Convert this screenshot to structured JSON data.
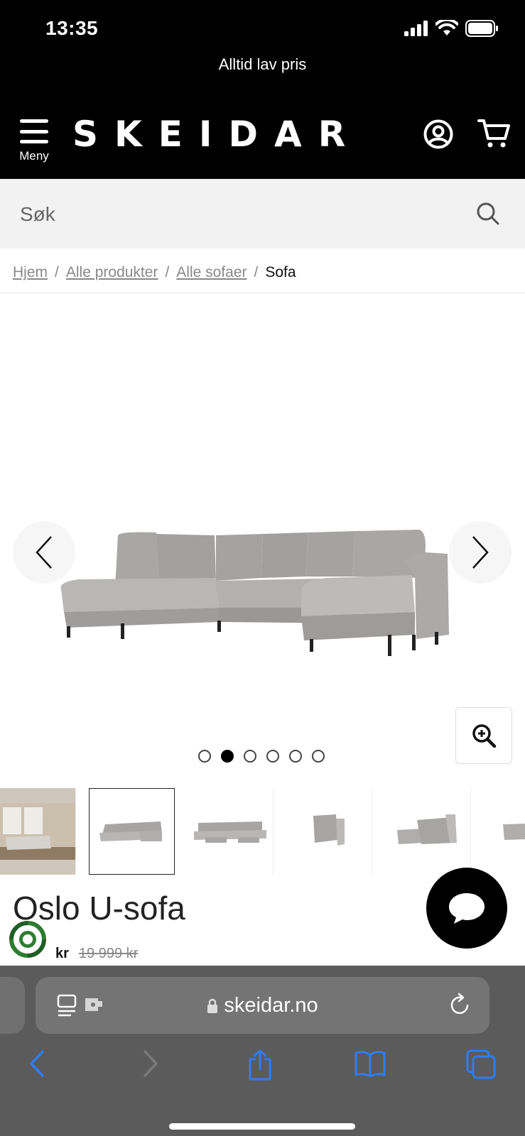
{
  "status_bar": {
    "time": "13:35"
  },
  "header": {
    "promo": "Alltid lav pris",
    "menu_label": "Meny",
    "logo": "SKEIDAR"
  },
  "search": {
    "placeholder": "Søk"
  },
  "breadcrumb": {
    "items": [
      "Hjem",
      "Alle produkter",
      "Alle sofaer"
    ],
    "current": "Sofa",
    "separator": "/"
  },
  "gallery": {
    "dots_count": 6,
    "active_dot_index": 1,
    "thumbnail_count": 6,
    "selected_thumbnail_index": 1
  },
  "product": {
    "title": "Oslo U-sofa",
    "price_currency": "kr",
    "price_old": "19 999 kr"
  },
  "browser": {
    "url": "skeidar.no"
  },
  "colors": {
    "header_bg": "#000000",
    "search_bg": "#f2f2f2",
    "safari_bg": "#5b5b5b",
    "safari_accent": "#2f7df6",
    "eco_green": "#2e7d32"
  }
}
